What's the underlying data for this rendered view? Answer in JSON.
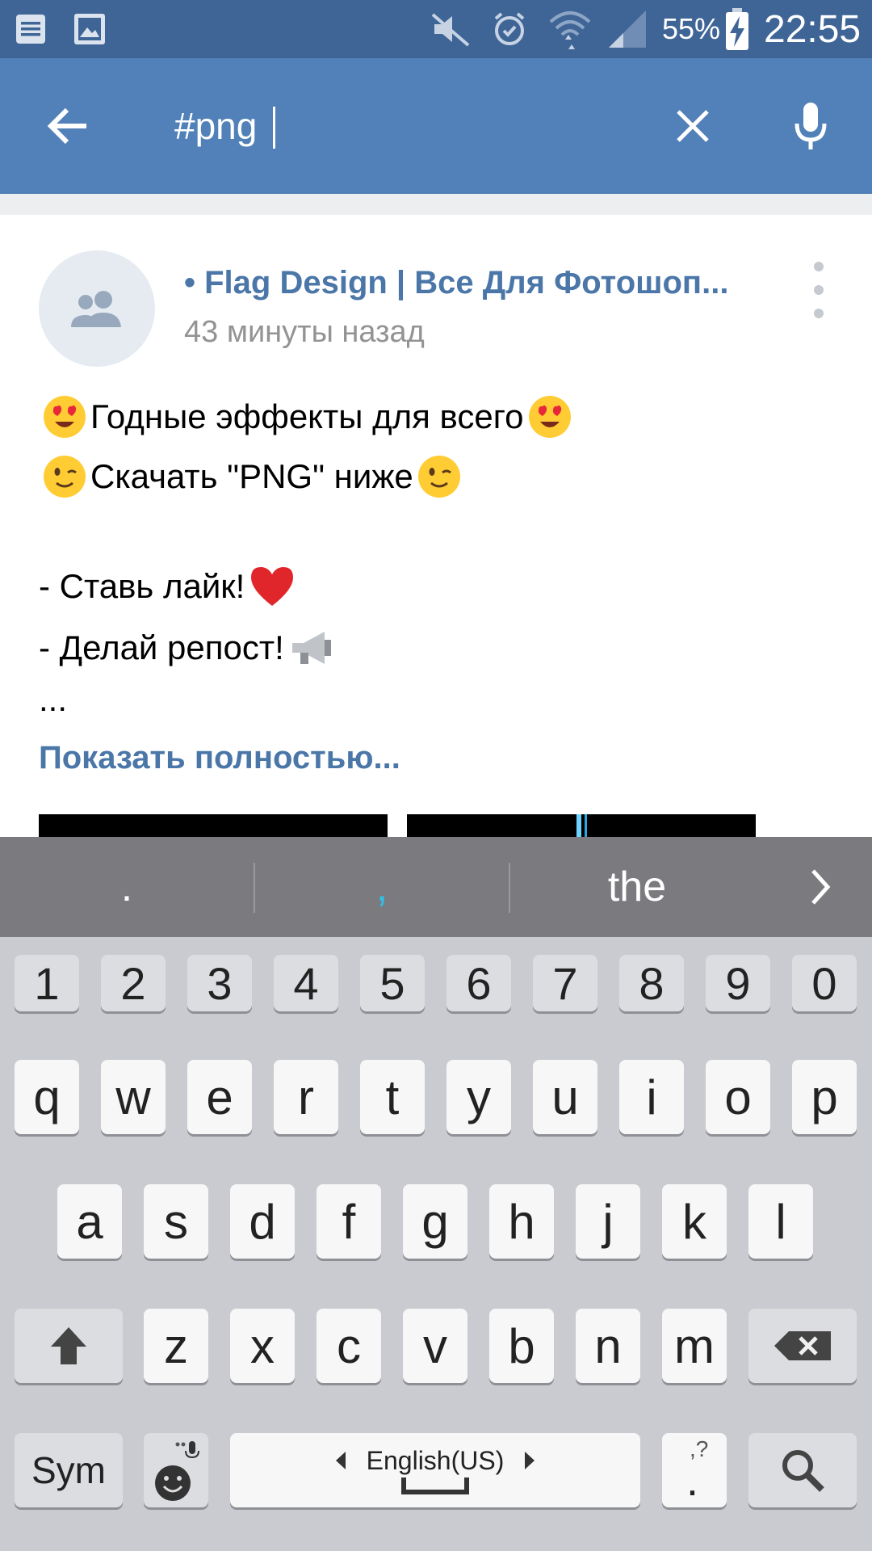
{
  "status_bar": {
    "battery": "55%",
    "time": "22:55",
    "icons": [
      "notes-icon",
      "gallery-icon",
      "mute-icon",
      "alarm-icon",
      "wifi-icon",
      "signal-icon",
      "battery-charging-icon"
    ]
  },
  "search": {
    "value": "#png",
    "back_icon": "arrow-left-icon",
    "clear_icon": "close-icon",
    "mic_icon": "microphone-icon"
  },
  "post": {
    "author": "• Flag Design | Все Для Фотошоп...",
    "time": "43 минуты назад",
    "lines": [
      "Годные эффекты для всего",
      "Скачать \"PNG\" ниже",
      "- Ставь лайк!",
      "- Делай репост!",
      " ..."
    ],
    "show_more": "Показать полностью..."
  },
  "keyboard": {
    "suggestions": [
      ".",
      ",",
      "the"
    ],
    "number_row": [
      "1",
      "2",
      "3",
      "4",
      "5",
      "6",
      "7",
      "8",
      "9",
      "0"
    ],
    "row1": [
      "q",
      "w",
      "e",
      "r",
      "t",
      "y",
      "u",
      "i",
      "o",
      "p"
    ],
    "row2": [
      "a",
      "s",
      "d",
      "f",
      "g",
      "h",
      "j",
      "k",
      "l"
    ],
    "row3": [
      "z",
      "x",
      "c",
      "v",
      "b",
      "n",
      "m"
    ],
    "sym_label": "Sym",
    "space_label": "English(US)",
    "period_key": ".",
    "period_hint": ",?"
  },
  "colors": {
    "status_bar": "#3f6597",
    "header": "#5181b8",
    "link": "#4a76a8",
    "suggestion_bar": "#7b7b7f",
    "keyboard_bg": "#c9cbd0",
    "comma_accent": "#2fc1e8"
  }
}
